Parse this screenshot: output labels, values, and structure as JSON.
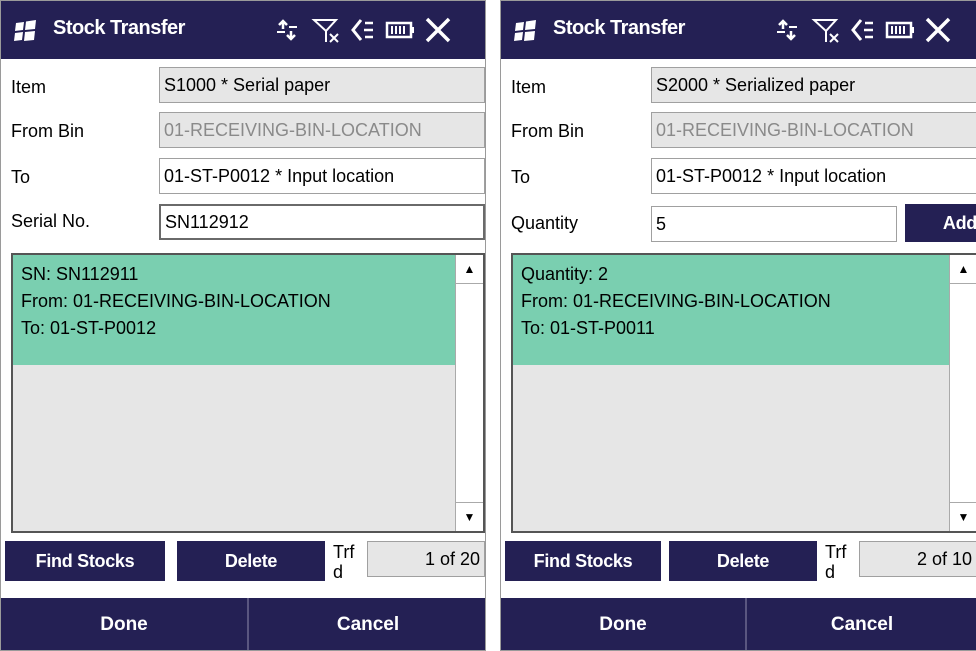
{
  "screens": [
    {
      "title": "Stock Transfer",
      "item_label": "Item",
      "item_value": "S1000 * Serial paper",
      "from_bin_label": "From Bin",
      "from_bin_value": "01-RECEIVING-BIN-LOCATION",
      "to_label": "To",
      "to_value": "01-ST-P0012 * Input location",
      "input_label": "Serial No.",
      "input_value": "SN112912",
      "entry": {
        "line1": "SN: SN112911",
        "line2": "From: 01-RECEIVING-BIN-LOCATION",
        "line3": "To: 01-ST-P0012"
      },
      "find_stocks": "Find Stocks",
      "delete": "Delete",
      "trf_label": "Trf d",
      "counter": "1 of 20",
      "done": "Done",
      "cancel": "Cancel"
    },
    {
      "title": "Stock Transfer",
      "item_label": "Item",
      "item_value": "S2000 * Serialized paper",
      "from_bin_label": "From Bin",
      "from_bin_value": "01-RECEIVING-BIN-LOCATION",
      "to_label": "To",
      "to_value": "01-ST-P0012 * Input location",
      "input_label": "Quantity",
      "input_value": "5",
      "add": "Add",
      "entry": {
        "line1": "Quantity: 2",
        "line2": "From: 01-RECEIVING-BIN-LOCATION",
        "line3": "To: 01-ST-P0011"
      },
      "find_stocks": "Find Stocks",
      "delete": "Delete",
      "trf_label": "Trf d",
      "counter": "2 of 10",
      "done": "Done",
      "cancel": "Cancel"
    }
  ],
  "icons": [
    "windows-logo-icon",
    "connectivity-icon",
    "no-signal-icon",
    "speaker-icon",
    "battery-icon",
    "close-icon"
  ],
  "colors": {
    "titlebar": "#242054",
    "selected_entry": "#7acfb0",
    "readonly_field": "#e6e6e6"
  }
}
